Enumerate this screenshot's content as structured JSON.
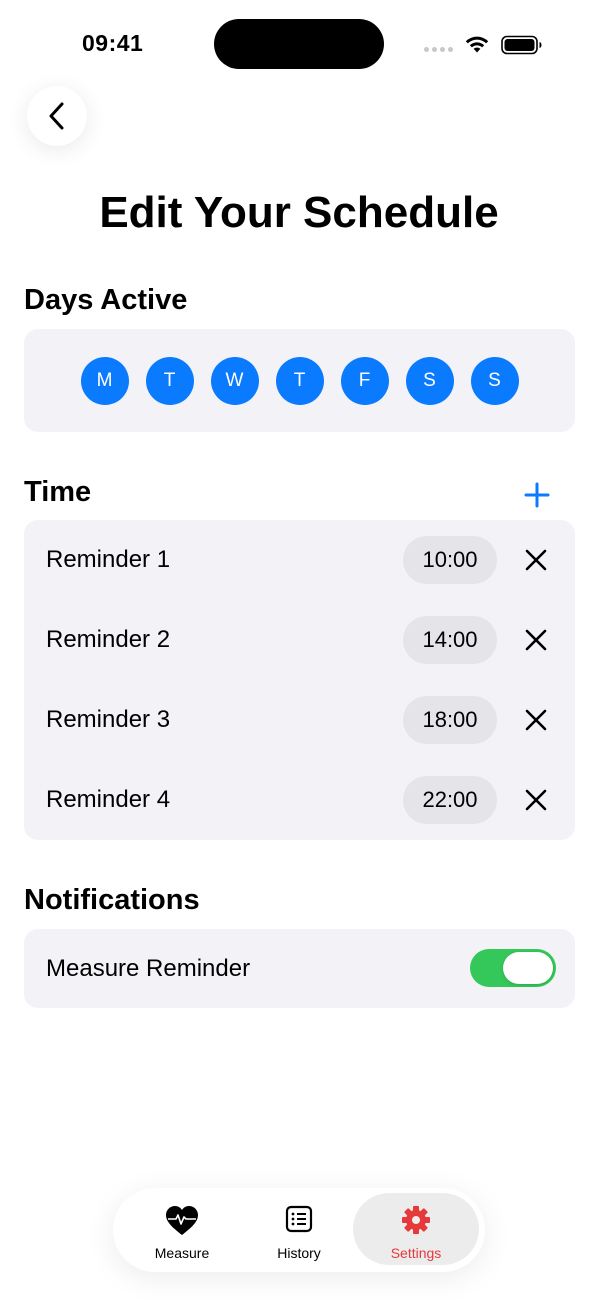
{
  "status_bar": {
    "time": "09:41"
  },
  "header": {
    "title": "Edit Your Schedule"
  },
  "days_active": {
    "title": "Days Active",
    "days": [
      {
        "label": "M",
        "selected": true
      },
      {
        "label": "T",
        "selected": true
      },
      {
        "label": "W",
        "selected": true
      },
      {
        "label": "T",
        "selected": true
      },
      {
        "label": "F",
        "selected": true
      },
      {
        "label": "S",
        "selected": true
      },
      {
        "label": "S",
        "selected": true
      }
    ]
  },
  "time_section": {
    "title": "Time",
    "add_icon": "plus-icon",
    "reminders": [
      {
        "label": "Reminder 1",
        "time": "10:00"
      },
      {
        "label": "Reminder 2",
        "time": "14:00"
      },
      {
        "label": "Reminder 3",
        "time": "18:00"
      },
      {
        "label": "Reminder 4",
        "time": "22:00"
      }
    ]
  },
  "notifications": {
    "title": "Notifications",
    "measure_reminder": {
      "label": "Measure Reminder",
      "enabled": true
    }
  },
  "tab_bar": {
    "tabs": [
      {
        "label": "Measure",
        "icon": "heart-pulse-icon",
        "active": false
      },
      {
        "label": "History",
        "icon": "list-icon",
        "active": false
      },
      {
        "label": "Settings",
        "icon": "gear-icon",
        "active": true
      }
    ]
  },
  "colors": {
    "accent_blue": "#0a7aff",
    "toggle_green": "#34c759",
    "active_tab_red": "#e5393b",
    "card_bg": "#f2f2f7"
  }
}
